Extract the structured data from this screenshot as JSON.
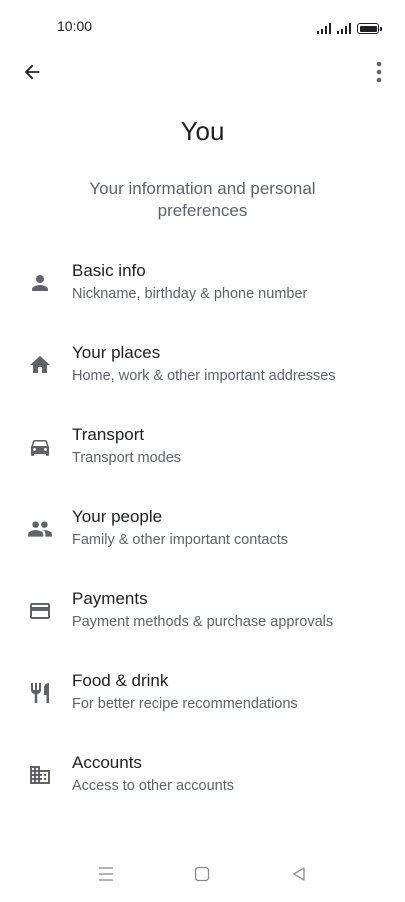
{
  "status_bar": {
    "time": "10:00"
  },
  "header": {
    "title": "You",
    "subtitle": "Your information and personal preferences"
  },
  "menu": [
    {
      "title": "Basic info",
      "description": "Nickname, birthday & phone number",
      "icon": "person-icon"
    },
    {
      "title": "Your places",
      "description": "Home, work & other important addresses",
      "icon": "home-icon"
    },
    {
      "title": "Transport",
      "description": "Transport modes",
      "icon": "car-icon"
    },
    {
      "title": "Your people",
      "description": "Family & other important contacts",
      "icon": "people-icon"
    },
    {
      "title": "Payments",
      "description": "Payment methods & purchase approvals",
      "icon": "credit-card-icon"
    },
    {
      "title": "Food & drink",
      "description": "For better recipe recommendations",
      "icon": "utensils-icon"
    },
    {
      "title": "Accounts",
      "description": "Access to other accounts",
      "icon": "building-icon"
    }
  ],
  "colors": {
    "text_primary": "#202124",
    "text_secondary": "#5f6368",
    "icon": "#5f6368",
    "background": "#ffffff"
  }
}
